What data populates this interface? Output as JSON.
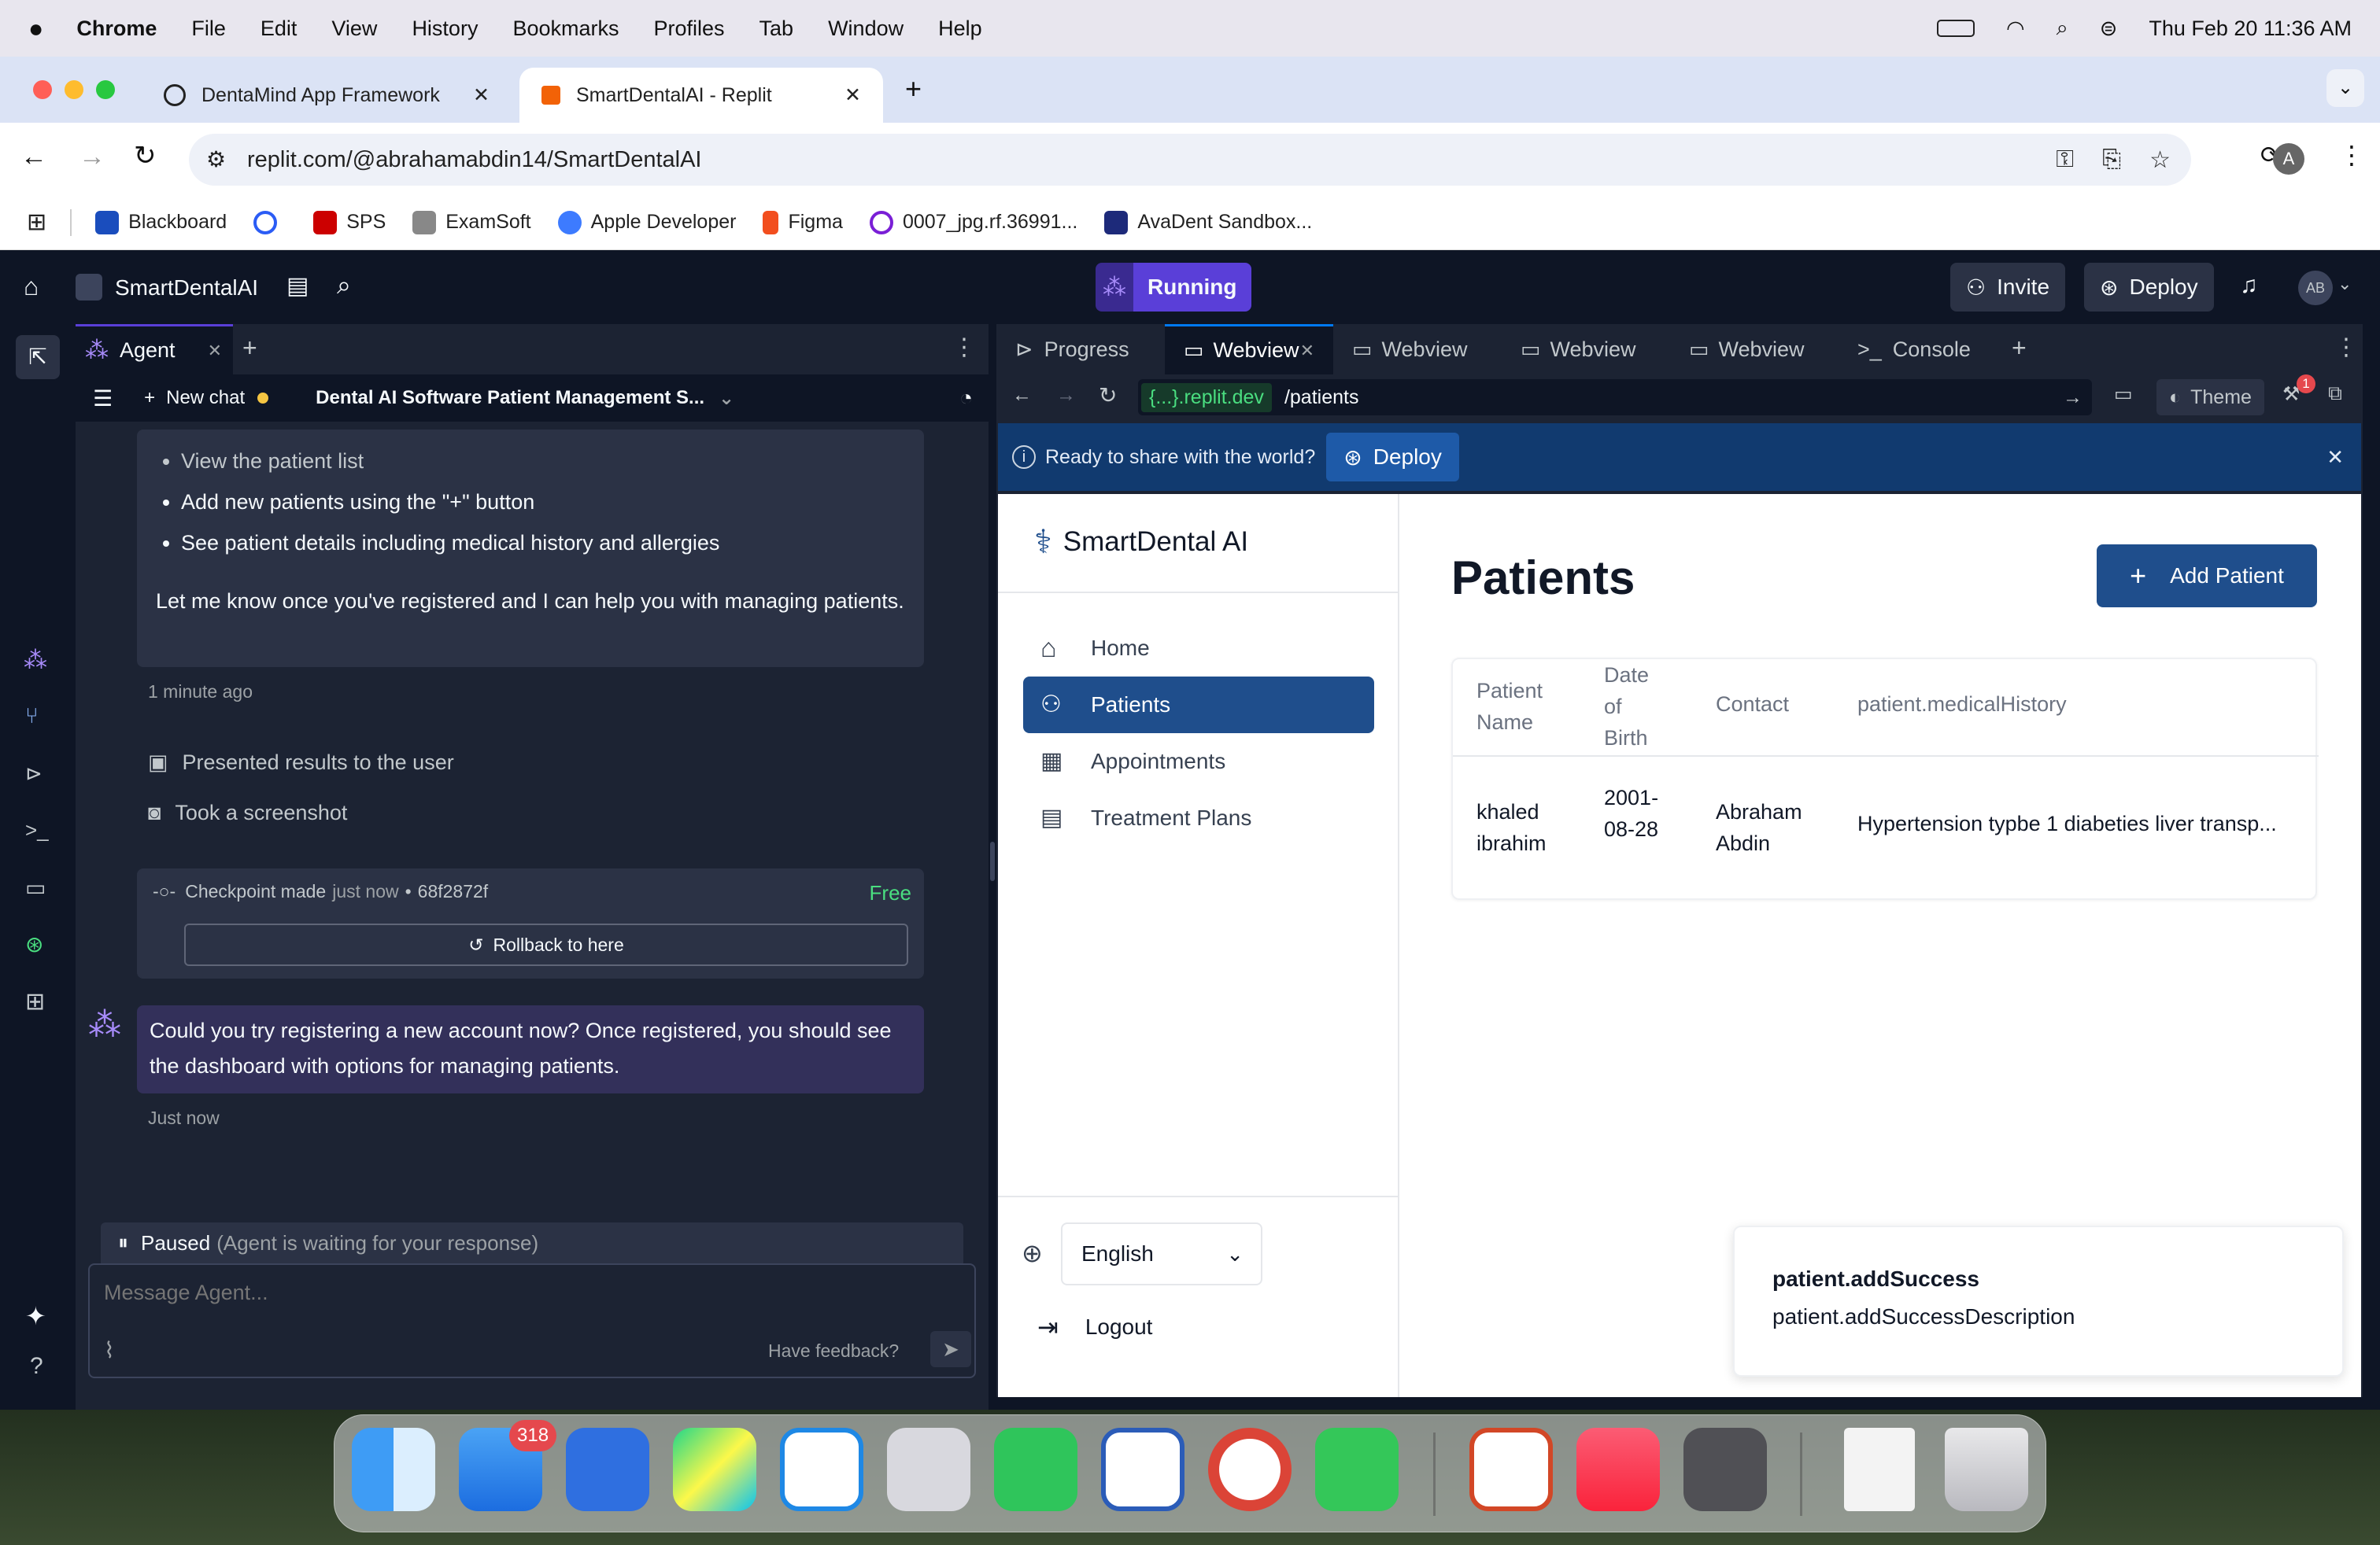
{
  "menubar": {
    "app": "Chrome",
    "items": [
      "File",
      "Edit",
      "View",
      "History",
      "Bookmarks",
      "Profiles",
      "Tab",
      "Window",
      "Help"
    ],
    "datetime": "Thu Feb 20  11:36 AM"
  },
  "browser": {
    "tabs": [
      {
        "label": "DentaMind App Framework"
      },
      {
        "label": "SmartDentalAI - Replit"
      }
    ],
    "url": "replit.com/@abrahamabdin14/SmartDentalAI",
    "profile_initial": "A",
    "bookmarks": [
      "Blackboard",
      "SPS",
      "ExamSoft",
      "Apple Developer",
      "Figma",
      "0007_jpg.rf.36991...",
      "AvaDent Sandbox..."
    ]
  },
  "replit": {
    "project": "SmartDentalAI",
    "status": "Running",
    "invite": "Invite",
    "deploy": "Deploy",
    "avatar": "AB",
    "agent": {
      "tab": "Agent",
      "new_chat": "New chat",
      "chat_title": "Dental AI Software Patient Management S...",
      "bullets": [
        "View the patient list",
        "Add new patients using the \"+\" button",
        "See patient details including medical history and allergies"
      ],
      "message1": "Let me know once you've registered and I can help you with managing patients.",
      "time1": "1 minute ago",
      "actions": [
        "Presented results to the user",
        "Took a screenshot"
      ],
      "checkpoint_label": "Checkpoint made",
      "checkpoint_when": "just now",
      "checkpoint_hash": "68f2872f",
      "checkpoint_cost": "Free",
      "rollback": "Rollback to here",
      "message2": "Could you try registering a new account now? Once registered, you should see the dashboard with options for managing patients.",
      "time2": "Just now",
      "paused": "Paused",
      "paused_detail": "(Agent is waiting for your response)",
      "input_placeholder": "Message Agent...",
      "feedback": "Have feedback?"
    },
    "right_tabs": [
      "Progress",
      "Webview",
      "Webview",
      "Webview",
      "Webview",
      "Console"
    ],
    "webview_bar": {
      "domain": "{...}.replit.dev",
      "path": "/patients",
      "theme": "Theme",
      "badge": "1"
    },
    "banner": {
      "text": "Ready to share with the world?",
      "button": "Deploy"
    }
  },
  "app": {
    "brand": "SmartDental AI",
    "nav": [
      {
        "label": "Home"
      },
      {
        "label": "Patients"
      },
      {
        "label": "Appointments"
      },
      {
        "label": "Treatment Plans"
      }
    ],
    "language": "English",
    "logout": "Logout",
    "page_title": "Patients",
    "add_button": "Add Patient",
    "table": {
      "headers": [
        "Patient Name",
        "Date of Birth",
        "Contact",
        "patient.medicalHistory"
      ],
      "rows": [
        [
          "khaled ibrahim",
          "2001-08-28",
          "Abraham Abdin",
          "Hypertension typbe 1 diabeties liver transp..."
        ]
      ]
    },
    "toast": {
      "title": "patient.addSuccess",
      "description": "patient.addSuccessDescription"
    }
  },
  "dock": {
    "mail_badge": "318"
  },
  "colors": {
    "replit_bg": "#0e1525",
    "panel": "#1c2333",
    "accent_blue": "#1f4e8c",
    "running": "#5a3fd8",
    "banner": "#113a6f"
  }
}
